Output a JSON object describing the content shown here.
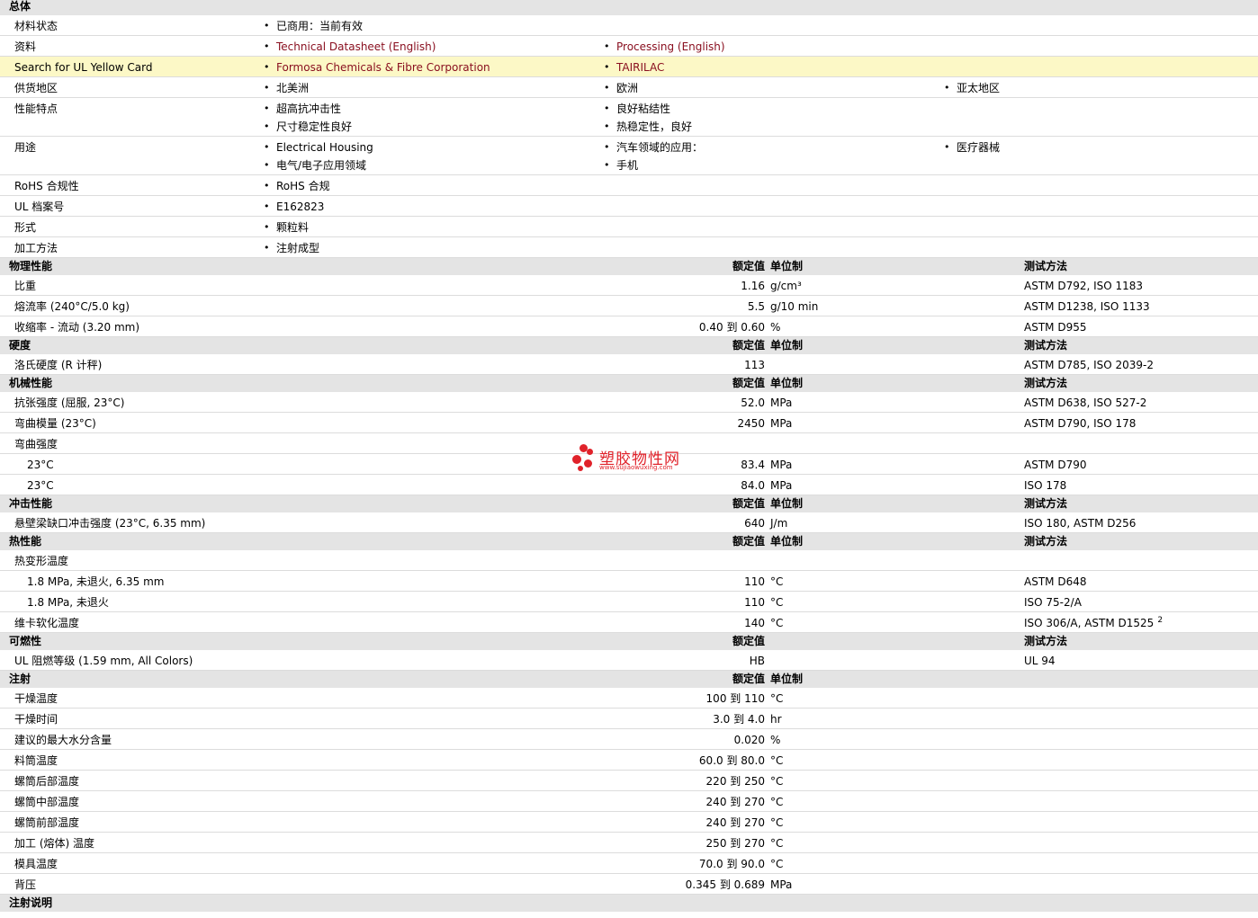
{
  "general": {
    "title": "总体",
    "rows": [
      {
        "label": "材料状态",
        "values": [
          [
            "已商用：当前有效"
          ]
        ]
      },
      {
        "label": "资料",
        "sup": "1",
        "values": [
          [
            "Technical Datasheet (English)"
          ],
          [
            "Processing (English)"
          ]
        ]
      },
      {
        "label": "Search for UL Yellow Card",
        "values": [
          [
            "Formosa Chemicals & Fibre Corporation"
          ],
          [
            "TAIRILAC"
          ]
        ]
      },
      {
        "label": "供货地区",
        "values": [
          [
            "北美洲"
          ],
          [
            "欧洲"
          ],
          [
            "亚太地区"
          ]
        ]
      },
      {
        "label": "性能特点",
        "values": [
          [
            "超高抗冲击性",
            "尺寸稳定性良好"
          ],
          [
            "良好粘结性",
            "热稳定性，良好"
          ]
        ]
      },
      {
        "label": "用途",
        "values": [
          [
            "Electrical Housing",
            "电气/电子应用领域"
          ],
          [
            "汽车领域的应用：",
            "手机"
          ],
          [
            "医疗器械"
          ]
        ]
      },
      {
        "label": "RoHS 合规性",
        "values": [
          [
            "RoHS 合规"
          ]
        ]
      },
      {
        "label": "UL 档案号",
        "values": [
          [
            "E162823"
          ]
        ]
      },
      {
        "label": "形式",
        "values": [
          [
            "颗粒料"
          ]
        ]
      },
      {
        "label": "加工方法",
        "values": [
          [
            "注射成型"
          ]
        ]
      }
    ]
  },
  "columns": {
    "nominal": "额定值",
    "unit": "单位制",
    "method": "测试方法"
  },
  "sections": [
    {
      "title": "物理性能",
      "unit_col": true,
      "method_col": true,
      "rows": [
        {
          "label": "比重",
          "value": "1.16",
          "unit": "g/cm³",
          "method": "ASTM D792, ISO 1183"
        },
        {
          "label": "熔流率 (240°C/5.0 kg)",
          "value": "5.5",
          "unit": "g/10 min",
          "method": "ASTM D1238, ISO 1133"
        },
        {
          "label": "收缩率 - 流动 (3.20 mm)",
          "value": "0.40 到  0.60",
          "unit": "%",
          "method": "ASTM D955"
        }
      ]
    },
    {
      "title": "硬度",
      "unit_col": true,
      "method_col": true,
      "rows": [
        {
          "label": "洛氏硬度 (R 计秤)",
          "value": "113",
          "unit": "",
          "method": "ASTM D785, ISO 2039-2"
        }
      ]
    },
    {
      "title": "机械性能",
      "unit_col": true,
      "method_col": true,
      "rows": [
        {
          "label": "抗张强度 (屈服, 23°C)",
          "value": "52.0",
          "unit": "MPa",
          "method": "ASTM D638, ISO 527-2"
        },
        {
          "label": "弯曲模量 (23°C)",
          "value": "2450",
          "unit": "MPa",
          "method": "ASTM D790, ISO 178"
        },
        {
          "label": "弯曲强度",
          "value": "",
          "unit": "",
          "method": ""
        },
        {
          "label": "23°C",
          "indent": true,
          "value": "83.4",
          "unit": "MPa",
          "method": "ASTM D790"
        },
        {
          "label": "23°C",
          "indent": true,
          "value": "84.0",
          "unit": "MPa",
          "method": "ISO 178"
        }
      ]
    },
    {
      "title": "冲击性能",
      "unit_col": true,
      "method_col": true,
      "rows": [
        {
          "label": "悬壁梁缺口冲击强度 (23°C, 6.35 mm)",
          "value": "640",
          "unit": "J/m",
          "method": "ISO 180, ASTM D256"
        }
      ]
    },
    {
      "title": "热性能",
      "unit_col": true,
      "method_col": true,
      "rows": [
        {
          "label": "热变形温度",
          "value": "",
          "unit": "",
          "method": ""
        },
        {
          "label": "1.8 MPa, 未退火, 6.35 mm",
          "indent": true,
          "value": "110",
          "unit": "°C",
          "method": "ASTM D648"
        },
        {
          "label": "1.8 MPa, 未退火",
          "indent": true,
          "value": "110",
          "unit": "°C",
          "method": "ISO 75-2/A"
        },
        {
          "label": "维卡软化温度",
          "value": "140",
          "unit": "°C",
          "method": "ISO 306/A, ASTM D1525",
          "method_sup": "2"
        }
      ]
    },
    {
      "title": "可燃性",
      "unit_col": false,
      "method_col": true,
      "rows": [
        {
          "label": "UL 阻燃等级 (1.59 mm, All Colors)",
          "value": "HB",
          "unit": "",
          "method": "UL 94"
        }
      ]
    },
    {
      "title": "注射",
      "unit_col": true,
      "method_col": false,
      "rows": [
        {
          "label": "干燥温度",
          "value": "100 到  110",
          "unit": "°C",
          "method": ""
        },
        {
          "label": "干燥时间",
          "value": "3.0 到  4.0",
          "unit": "hr",
          "method": ""
        },
        {
          "label": "建议的最大水分含量",
          "value": "0.020",
          "unit": "%",
          "method": ""
        },
        {
          "label": "料筒温度",
          "value": "60.0 到  80.0",
          "unit": "°C",
          "method": ""
        },
        {
          "label": "螺筒后部温度",
          "value": "220 到  250",
          "unit": "°C",
          "method": ""
        },
        {
          "label": "螺筒中部温度",
          "value": "240 到  270",
          "unit": "°C",
          "method": ""
        },
        {
          "label": "螺筒前部温度",
          "value": "240 到  270",
          "unit": "°C",
          "method": ""
        },
        {
          "label": "加工 (熔体) 温度",
          "value": "250 到  270",
          "unit": "°C",
          "method": ""
        },
        {
          "label": "模具温度",
          "value": "70.0 到  90.0",
          "unit": "°C",
          "method": ""
        },
        {
          "label": "背压",
          "value": "0.345 到  0.689",
          "unit": "MPa",
          "method": ""
        }
      ]
    },
    {
      "title": "注射说明",
      "unit_col": false,
      "method_col": false,
      "rows": []
    }
  ],
  "watermark": {
    "name": "塑胶物性网",
    "url": "www.sujiaowuxing.com"
  }
}
